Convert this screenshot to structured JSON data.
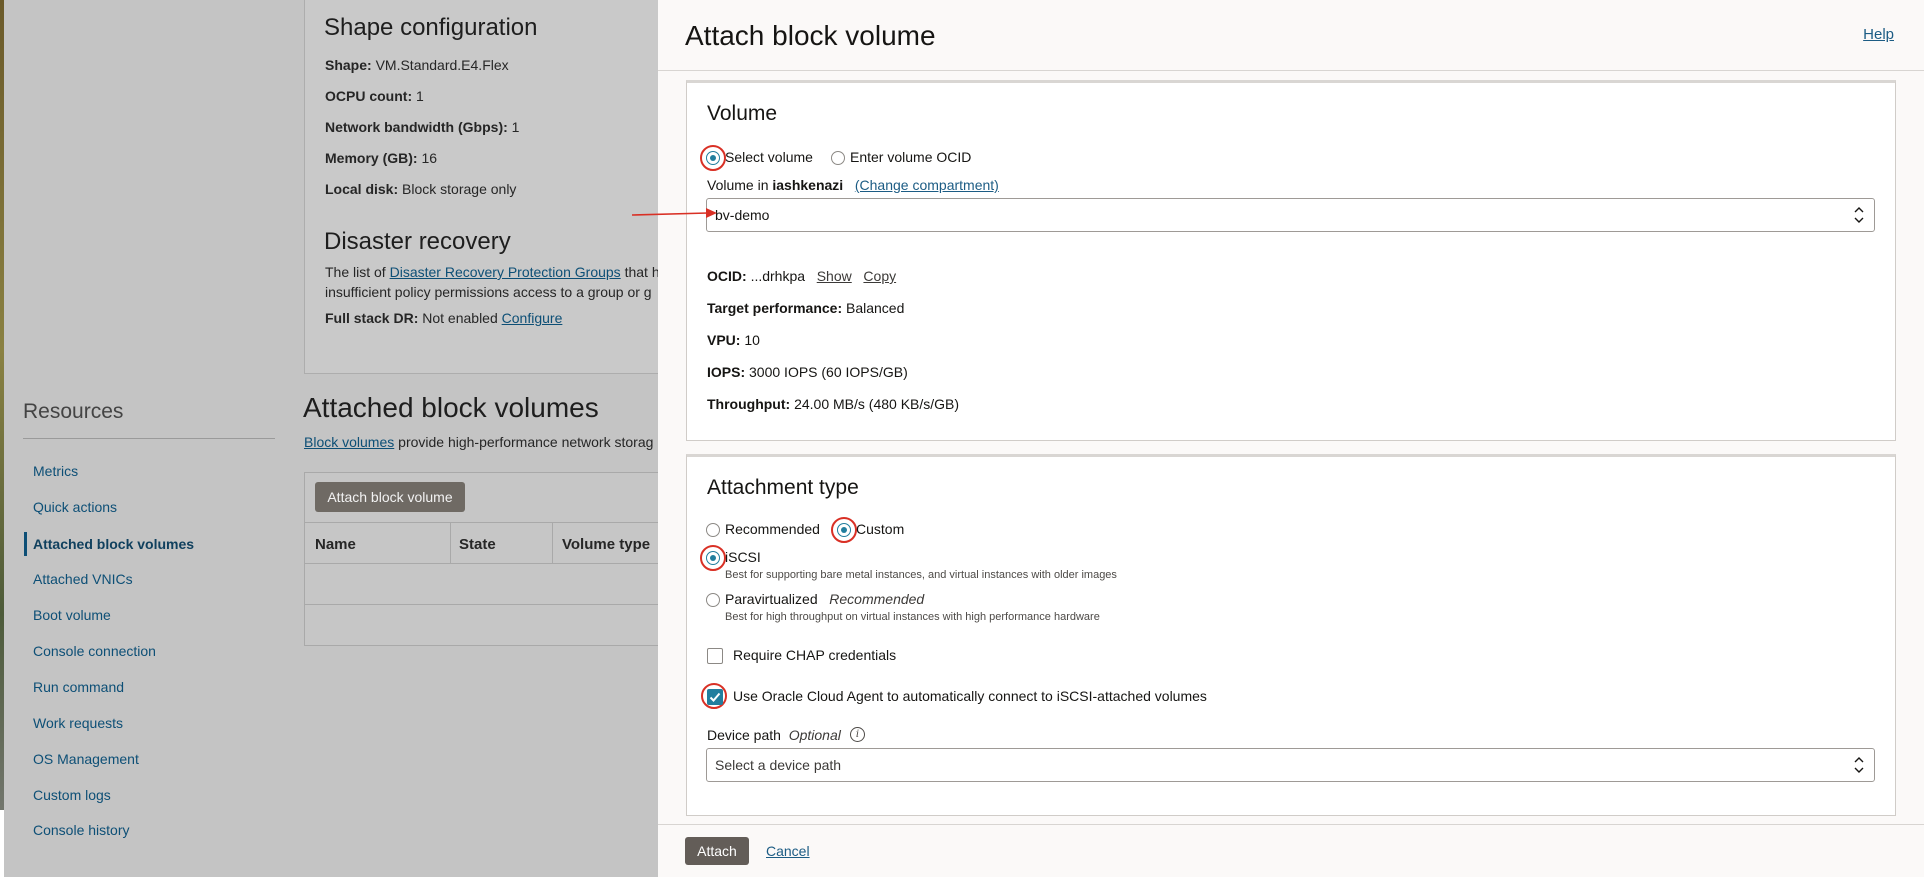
{
  "background": {
    "shape_config": {
      "title": "Shape configuration",
      "rows": [
        {
          "label": "Shape:",
          "value": "VM.Standard.E4.Flex"
        },
        {
          "label": "OCPU count:",
          "value": "1"
        },
        {
          "label": "Network bandwidth (Gbps):",
          "value": "1"
        },
        {
          "label": "Memory (GB):",
          "value": "16"
        },
        {
          "label": "Local disk:",
          "value": "Block storage only"
        }
      ]
    },
    "disaster_recovery": {
      "title": "Disaster recovery",
      "line1_prefix": "The list of ",
      "line1_link": "Disaster Recovery Protection Groups",
      "line1_suffix": " that h",
      "line2": "insufficient policy permissions access to a group or g",
      "fsdr_label": "Full stack DR:",
      "fsdr_value": "Not enabled",
      "fsdr_link": "Configure"
    },
    "resources": {
      "title": "Resources",
      "items": [
        "Metrics",
        "Quick actions",
        "Attached block volumes",
        "Attached VNICs",
        "Boot volume",
        "Console connection",
        "Run command",
        "Work requests",
        "OS Management",
        "Custom logs",
        "Console history"
      ]
    },
    "attached_block_volumes": {
      "title": "Attached block volumes",
      "desc_link": "Block volumes",
      "desc_text": " provide high-performance network storag",
      "button": "Attach block volume",
      "columns": [
        "Name",
        "State",
        "Volume type"
      ]
    }
  },
  "drawer": {
    "title": "Attach block volume",
    "help": "Help",
    "volume": {
      "title": "Volume",
      "radio_select": "Select volume",
      "radio_ocid": "Enter volume OCID",
      "compartment_prefix": "Volume in ",
      "compartment_name": "iashkenazi",
      "change_compartment": "(Change compartment)",
      "selected_volume": "bv-demo",
      "ocid_label": "OCID:",
      "ocid_value": "...drhkpa",
      "ocid_show": "Show",
      "ocid_copy": "Copy",
      "target_label": "Target performance:",
      "target_value": "Balanced",
      "vpu_label": "VPU:",
      "vpu_value": "10",
      "iops_label": "IOPS:",
      "iops_value": "3000 IOPS (60 IOPS/GB)",
      "throughput_label": "Throughput:",
      "throughput_value": "24.00 MB/s (480 KB/s/GB)"
    },
    "attachment": {
      "title": "Attachment type",
      "radio_recommended": "Recommended",
      "radio_custom": "Custom",
      "iscsi_label": "iSCSI",
      "iscsi_hint": "Best for supporting bare metal instances, and virtual instances with older images",
      "para_label": "Paravirtualized",
      "para_tag": "Recommended",
      "para_hint": "Best for high throughput on virtual instances with high performance hardware",
      "chap_label": "Require CHAP credentials",
      "agent_label": "Use Oracle Cloud Agent to automatically connect to iSCSI-attached volumes",
      "device_label": "Device path",
      "device_optional": "Optional",
      "device_placeholder": "Select a device path"
    },
    "footer": {
      "attach": "Attach",
      "cancel": "Cancel"
    }
  },
  "colors": {
    "accent": "#227e9e",
    "link": "#1c5c84",
    "annotation_red": "#d93025"
  }
}
